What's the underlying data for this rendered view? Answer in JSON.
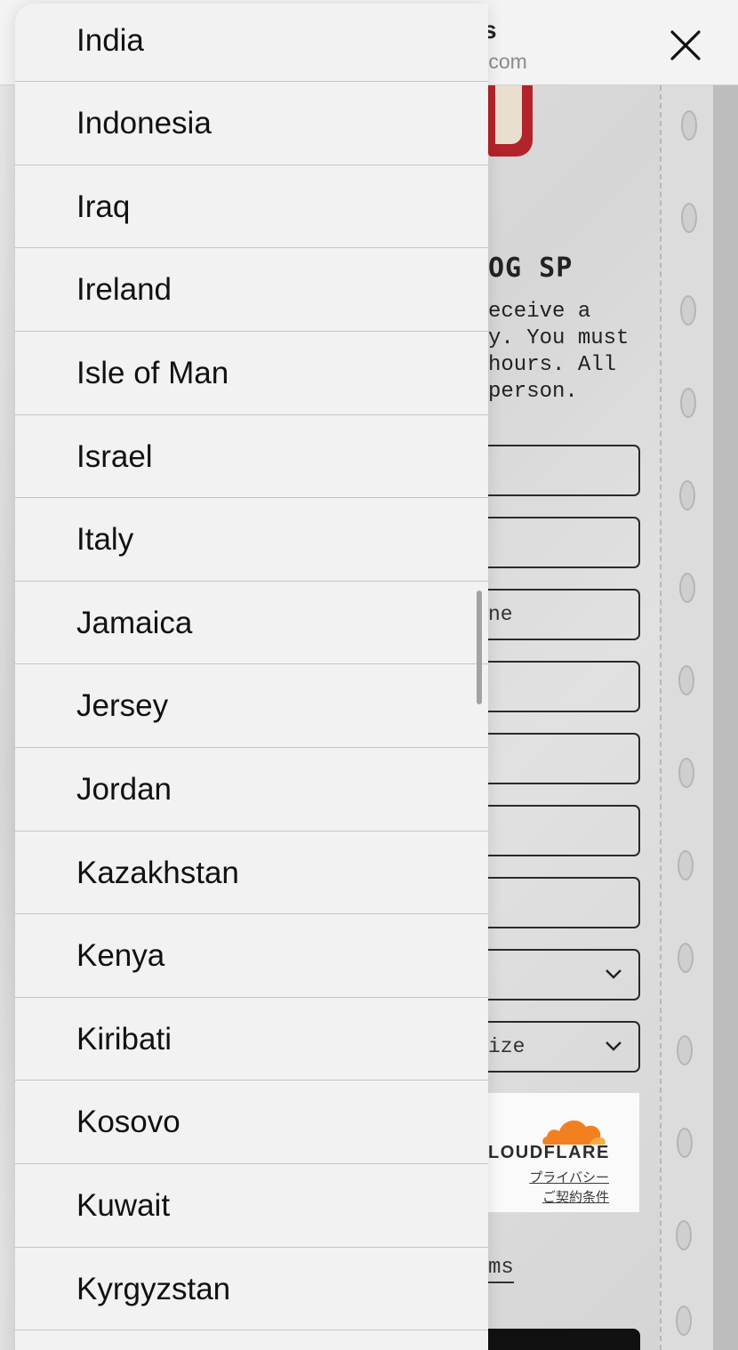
{
  "page": {
    "site_name_fragment": "s",
    "site_domain_fragment": ".com",
    "close_icon": "close-icon"
  },
  "form": {
    "heading_fragment": "OG SP",
    "description_lines": [
      "eceive a",
      "y. You must",
      "hours. All",
      "person."
    ],
    "fields": [
      {
        "text": ""
      },
      {
        "text": ""
      },
      {
        "text": "ne"
      },
      {
        "text": ""
      },
      {
        "text": ""
      },
      {
        "text": ""
      },
      {
        "text": ""
      },
      {
        "text": "",
        "icon": "chevron-down-icon"
      },
      {
        "text": "ize",
        "icon": "chevron-down-icon"
      }
    ],
    "captcha": {
      "brand_fragment": "LOUDFLARE",
      "privacy_link": "プライバシー",
      "terms_link": "ご契約条件",
      "brand_color": "#f38020"
    },
    "terms_link_fragment": "ms"
  },
  "picker": {
    "rows": [
      "India",
      "Indonesia",
      "Iraq",
      "Ireland",
      "Isle of Man",
      "Israel",
      "Italy",
      "Jamaica",
      "Jersey",
      "Jordan",
      "Kazakhstan",
      "Kenya",
      "Kiribati",
      "Kosovo",
      "Kuwait",
      "Kyrgyzstan",
      ""
    ]
  }
}
